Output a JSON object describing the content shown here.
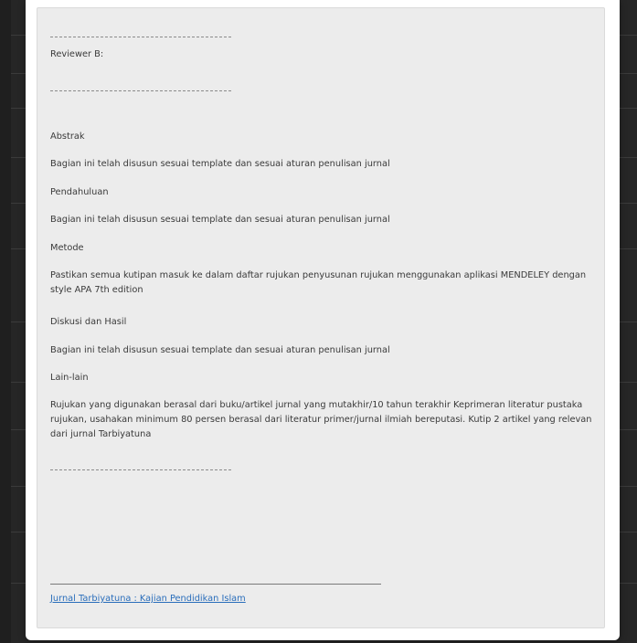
{
  "review": {
    "reviewer_label": "Reviewer B:",
    "sections": [
      {
        "heading": "Abstrak",
        "body": "Bagian ini telah disusun sesuai template dan sesuai aturan penulisan jurnal"
      },
      {
        "heading": "Pendahuluan",
        "body": "Bagian ini telah disusun sesuai template dan sesuai aturan penulisan jurnal"
      },
      {
        "heading": "Metode",
        "body": "Pastikan semua kutipan masuk ke dalam daftar rujukan penyusunan rujukan menggunakan aplikasi MENDELEY dengan style APA 7th edition"
      },
      {
        "heading": "Diskusi dan Hasil",
        "body": "Bagian ini telah disusun sesuai template dan sesuai aturan penulisan jurnal"
      },
      {
        "heading": "Lain-lain",
        "body": "Rujukan yang digunakan berasal dari buku/artikel jurnal yang mutakhir/10 tahun terakhir Keprimeran literatur pustaka rujukan, usahakan minimum 80 persen berasal dari literatur primer/jurnal ilmiah bereputasi. Kutip 2 artikel yang relevan dari jurnal Tarbiyatuna"
      }
    ]
  },
  "footer": {
    "journal_link": "Jurnal Tarbiyatuna : Kajian Pendidikan Islam"
  },
  "colors": {
    "link": "#2a6ebb",
    "panel": "#ececec",
    "backdrop": "#262626"
  }
}
